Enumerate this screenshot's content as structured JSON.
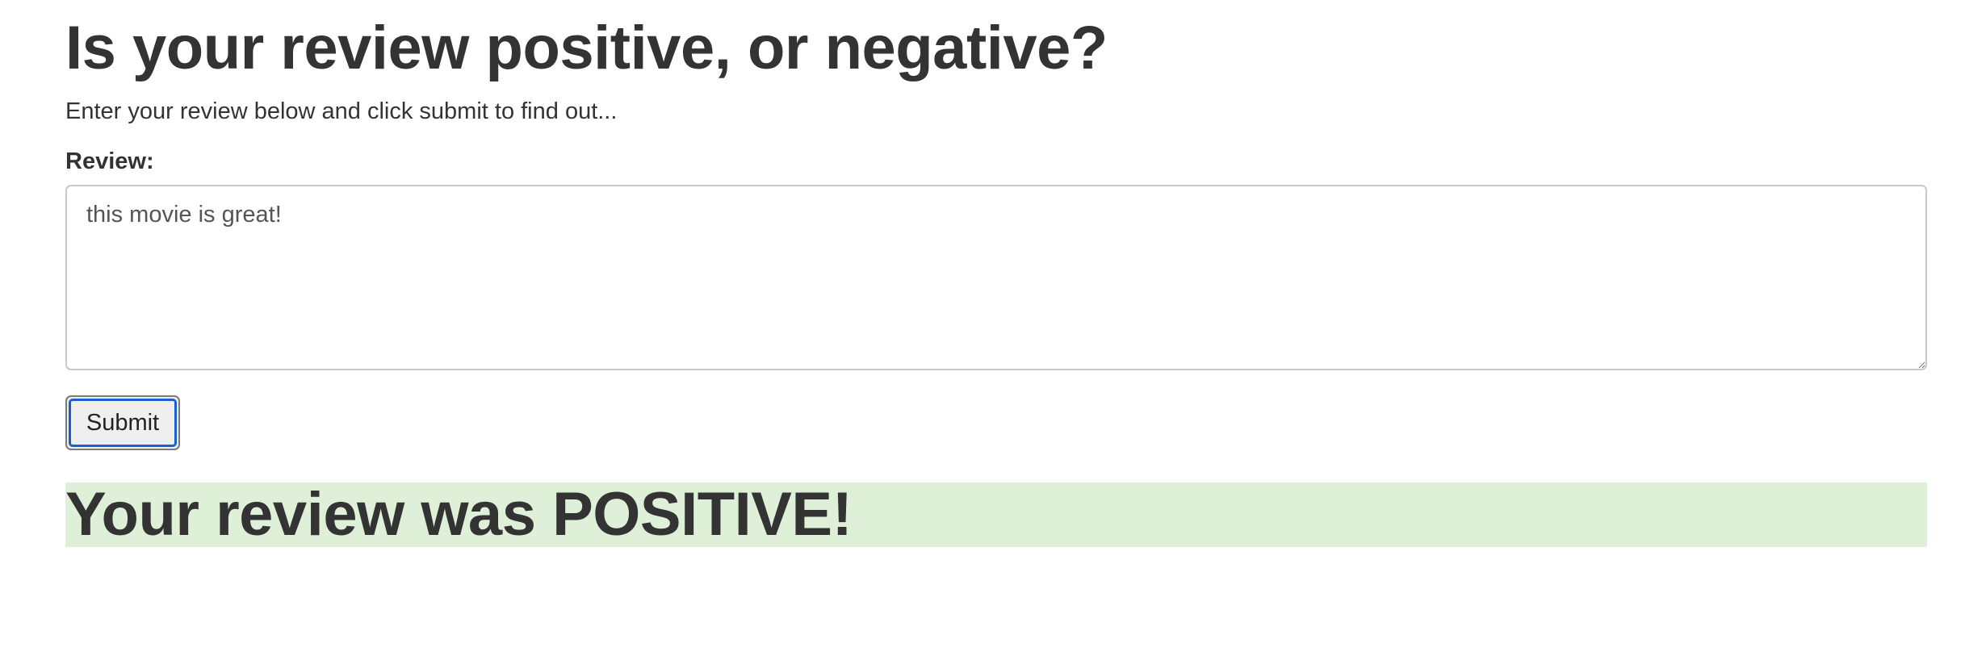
{
  "page": {
    "title": "Is your review positive, or negative?",
    "intro": "Enter your review below and click submit to find out..."
  },
  "form": {
    "review_label": "Review:",
    "review_value": "this movie is great!",
    "submit_label": "Submit"
  },
  "result": {
    "message": "Your review was POSITIVE!",
    "status": "positive",
    "background_color": "#dff0d8"
  },
  "colors": {
    "text": "#333333",
    "focus_ring": "#1a5fd0"
  }
}
